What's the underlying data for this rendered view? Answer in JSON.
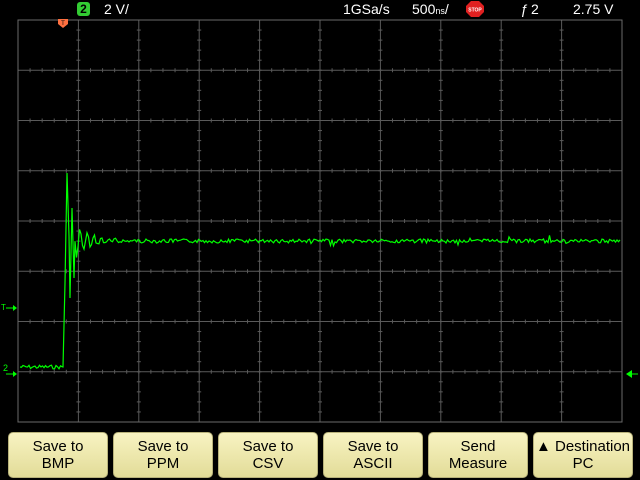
{
  "status_bar": {
    "channel_number": "2",
    "scale": "2 V/",
    "sample_rate": "1GSa/s",
    "timebase": "500",
    "timebase_unit": "ns",
    "acq_state": "STOP",
    "trigger_source": "2",
    "trigger_level": "2.75 V"
  },
  "markers": {
    "trigger_position": "T",
    "trigger_level_marker": "T",
    "channel_ground": "2"
  },
  "colors": {
    "trace": "#00ff00",
    "grid": "#5a5a5a",
    "softkey_bg": "#f3eeb8",
    "stop": "#e02020",
    "trigger_marker": "#ff7040"
  },
  "softkeys": [
    {
      "line1": "Save to",
      "line2": "BMP"
    },
    {
      "line1": "Save to",
      "line2": "PPM"
    },
    {
      "line1": "Save to",
      "line2": "CSV"
    },
    {
      "line1": "Save to",
      "line2": "ASCII"
    },
    {
      "line1": "Send",
      "line2": "Measure"
    },
    {
      "line1": "▲ Destination",
      "line2": "PC"
    }
  ]
}
